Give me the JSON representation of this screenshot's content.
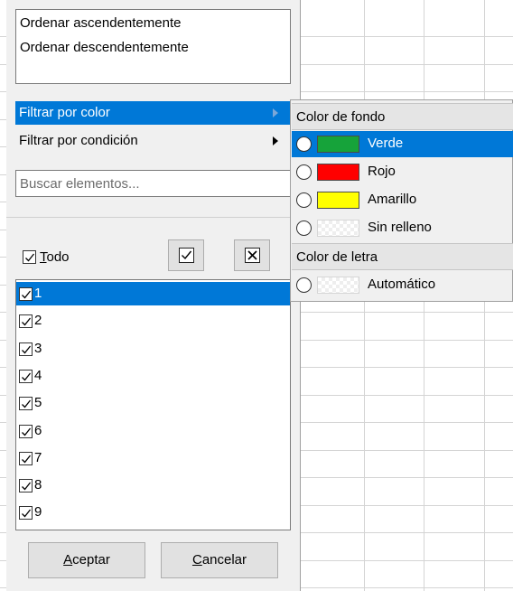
{
  "sort": {
    "ascending": "Ordenar ascendentemente",
    "descending": "Ordenar descendentemente"
  },
  "filter_menu": [
    {
      "label": "Filtrar por color",
      "has_submenu": true,
      "highlighted": true
    },
    {
      "label": "Filtrar por condición",
      "has_submenu": true,
      "highlighted": false
    }
  ],
  "search": {
    "placeholder": "Buscar elementos..."
  },
  "all_toggle": {
    "mnemonic": "T",
    "rest": "odo",
    "checked": true
  },
  "tool_buttons": {
    "check_all_icon": "check-square-icon",
    "uncheck_all_icon": "x-square-icon"
  },
  "values": [
    {
      "label": "1",
      "checked": true,
      "highlighted": true
    },
    {
      "label": "2",
      "checked": true
    },
    {
      "label": "3",
      "checked": true
    },
    {
      "label": "4",
      "checked": true
    },
    {
      "label": "5",
      "checked": true
    },
    {
      "label": "6",
      "checked": true
    },
    {
      "label": "7",
      "checked": true
    },
    {
      "label": "8",
      "checked": true
    },
    {
      "label": "9",
      "checked": true
    }
  ],
  "buttons": {
    "ok": {
      "mnemonic": "A",
      "rest": "ceptar"
    },
    "cancel": {
      "mnemonic": "C",
      "rest": "ancelar"
    }
  },
  "color_submenu": {
    "background_header": "Color de fondo",
    "background_colors": [
      {
        "label": "Verde",
        "swatch": "#16a33a",
        "highlighted": true
      },
      {
        "label": "Rojo",
        "swatch": "#ff0000"
      },
      {
        "label": "Amarillo",
        "swatch": "#ffff00"
      },
      {
        "label": "Sin relleno",
        "swatch": "none"
      }
    ],
    "text_header": "Color de letra",
    "text_colors": [
      {
        "label": "Automático",
        "swatch": "none"
      }
    ]
  },
  "colors": {
    "highlight": "#0078d7",
    "panel": "#f0f0f0",
    "grid": "#d4d4d4"
  }
}
